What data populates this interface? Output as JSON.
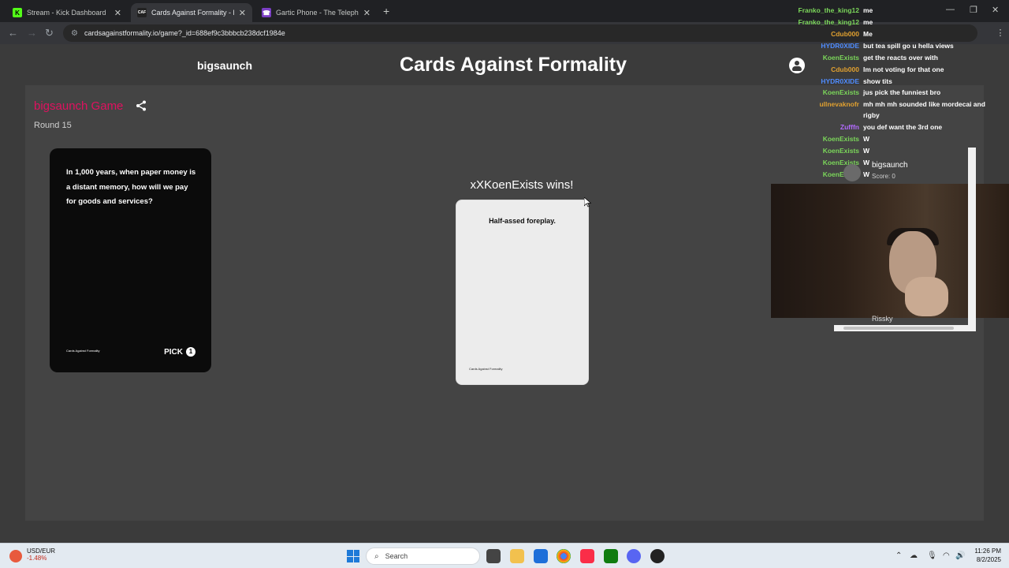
{
  "browser": {
    "tabs": [
      {
        "label": "Stream - Kick Dashboard",
        "favicon": "kick-icon",
        "active": false
      },
      {
        "label": "Cards Against Formality - Play C",
        "favicon": "caf-icon",
        "active": true
      },
      {
        "label": "Gartic Phone - The Telephone G",
        "favicon": "gartic-icon",
        "active": false
      }
    ],
    "url": "cardsagainstformality.io/game?_id=688ef9c3bbbcb238dcf1984e"
  },
  "site": {
    "username": "bigsaunch",
    "title": "Cards Against Formality"
  },
  "game": {
    "name": "bigsaunch Game",
    "round": "Round 15",
    "black_card": {
      "prompt": "In 1,000 years, when paper money is a distant memory, how will we pay for goods and services?",
      "brand": "Cards Against Formality",
      "pick_label": "PICK",
      "pick_count": "1"
    },
    "winner_text": "xXKoenExists wins!",
    "white_card": {
      "answer": "Half-assed foreplay.",
      "brand": "Cards Against Formality"
    }
  },
  "chat": [
    {
      "user": "Franko_the_king12",
      "msg": "me",
      "color": "#7bd65a"
    },
    {
      "user": "Franko_the_king12",
      "msg": "me",
      "color": "#7bd65a"
    },
    {
      "user": "Cdub000",
      "msg": "Me",
      "color": "#e0a030"
    },
    {
      "user": "HYDR0XIDE",
      "msg": "but tea spill go u hella views",
      "color": "#4f8cff"
    },
    {
      "user": "KoenExists",
      "msg": "get the reacts over with",
      "color": "#7bd65a"
    },
    {
      "user": "Cdub000",
      "msg": "Im not voting for that one",
      "color": "#e0a030"
    },
    {
      "user": "HYDR0XIDE",
      "msg": "show tits",
      "color": "#4f8cff"
    },
    {
      "user": "KoenExists",
      "msg": "jus pick the funniest bro",
      "color": "#7bd65a"
    },
    {
      "user": "ullnevaknofr",
      "msg": "mh mh mh sounded like mordecai and rigby",
      "color": "#e0a030"
    },
    {
      "user": "Zufffn",
      "msg": "you def want the 3rd one",
      "color": "#b36bff"
    },
    {
      "user": "KoenExists",
      "msg": "W",
      "color": "#7bd65a"
    },
    {
      "user": "KoenExists",
      "msg": "W",
      "color": "#7bd65a"
    },
    {
      "user": "KoenExists",
      "msg": "W",
      "color": "#7bd65a"
    },
    {
      "user": "KoenExists",
      "msg": "W",
      "color": "#7bd65a"
    }
  ],
  "scoreboard": {
    "player": "bigsaunch",
    "score": "Score: 0",
    "other": "Rissky"
  },
  "taskbar": {
    "stock_pair": "USD/EUR",
    "stock_change": "-1.48%",
    "search_placeholder": "Search",
    "time": "11:26 PM",
    "date": "8/2/2025"
  }
}
